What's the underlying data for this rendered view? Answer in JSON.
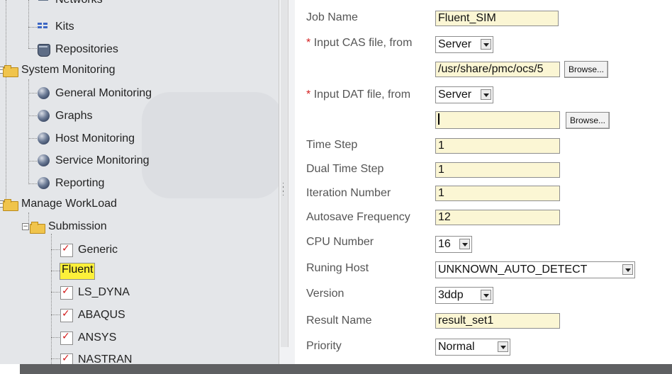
{
  "tree": {
    "networks": "Networks",
    "kits": "Kits",
    "repositories": "Repositories",
    "system_monitoring": "System Monitoring",
    "general_monitoring": "General Monitoring",
    "graphs": "Graphs",
    "host_monitoring": "Host Monitoring",
    "service_monitoring": "Service Monitoring",
    "reporting": "Reporting",
    "manage_workload": "Manage WorkLoad",
    "submission": "Submission",
    "generic": "Generic",
    "fluent": "Fluent",
    "ls_dyna": "LS_DYNA",
    "abaqus": "ABAQUS",
    "ansys": "ANSYS",
    "nastran": "NASTRAN",
    "expander_minus": "−",
    "required_marker": "*"
  },
  "form": {
    "job_name_label": "Job Name",
    "job_name_value": "Fluent_SIM",
    "cas_label": "Input CAS file, from",
    "cas_source": "Server",
    "cas_path": "/usr/share/pmc/ocs/5",
    "browse_label": "Browse...",
    "dat_label": "Input DAT file, from",
    "dat_source": "Server",
    "dat_path": "",
    "time_step_label": "Time Step",
    "time_step_value": "1",
    "dual_time_step_label": "Dual Time Step",
    "dual_time_step_value": "1",
    "iteration_label": "Iteration Number",
    "iteration_value": "1",
    "autosave_label": "Autosave Frequency",
    "autosave_value": "12",
    "cpu_label": "CPU Number",
    "cpu_value": "16",
    "host_label": "Runing Host",
    "host_value": "UNKNOWN_AUTO_DETECT",
    "version_label": "Version",
    "version_value": "3ddp",
    "result_label": "Result Name",
    "result_value": "result_set1",
    "priority_label": "Priority",
    "priority_value": "Normal"
  }
}
